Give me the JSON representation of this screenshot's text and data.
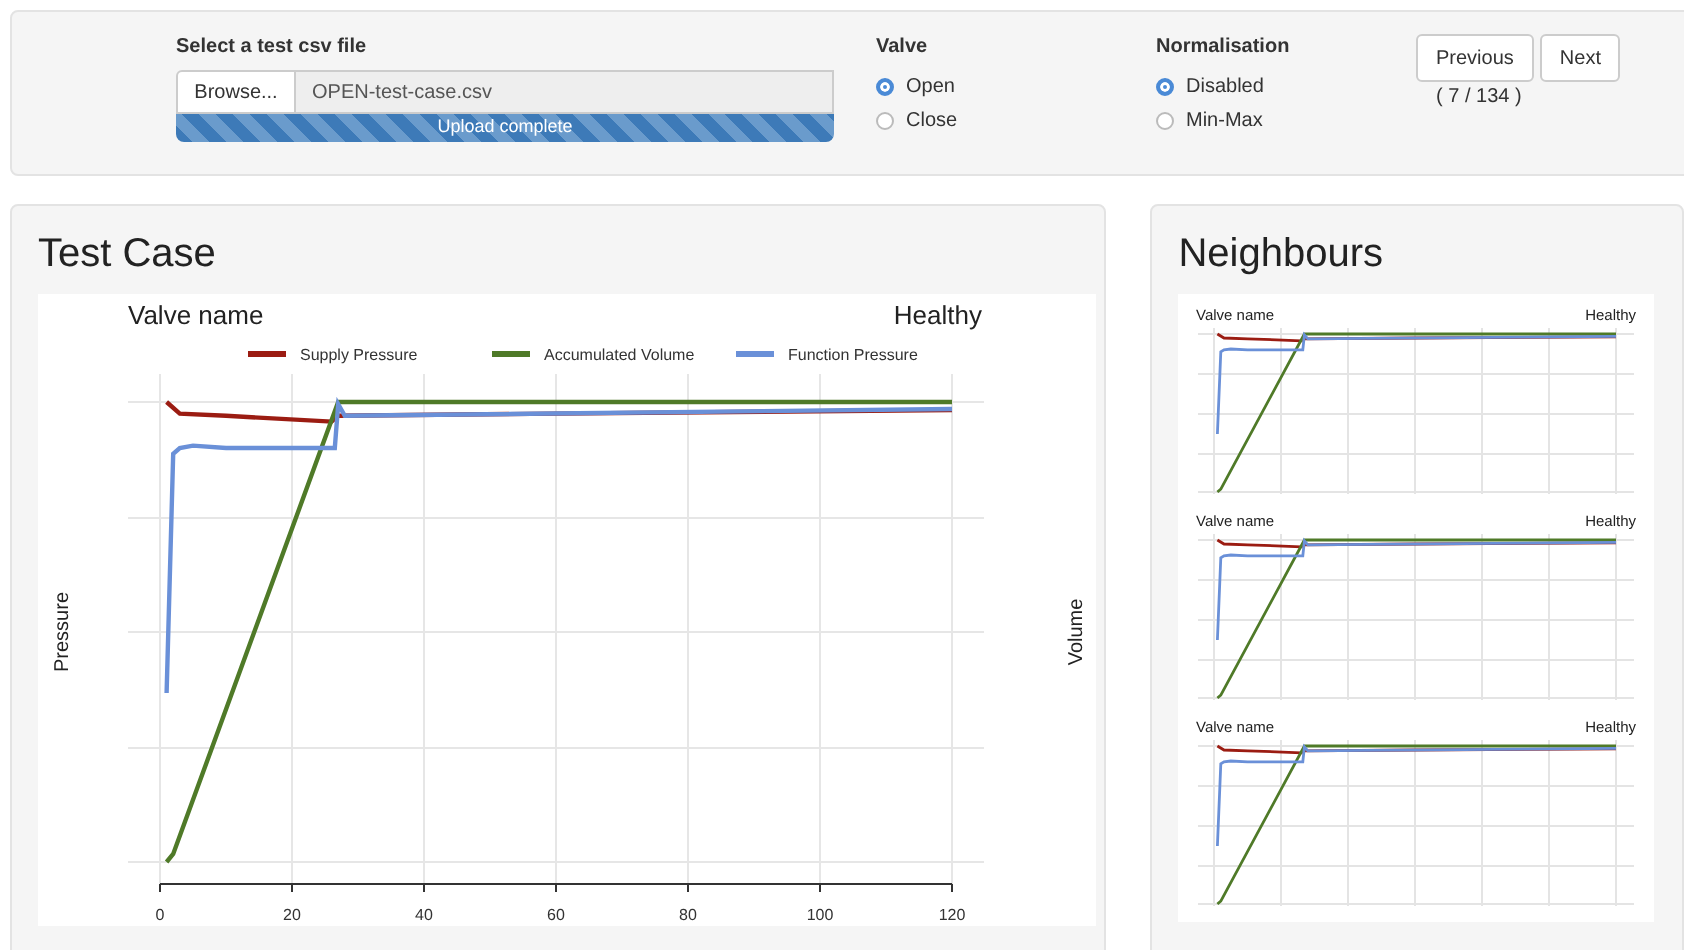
{
  "file_input": {
    "label": "Select a test csv file",
    "button": "Browse...",
    "value": "OPEN-test-case.csv",
    "progress": {
      "level": 1,
      "text": "Upload complete"
    }
  },
  "valve": {
    "label": "Valve",
    "options": [
      {
        "label": "Open",
        "selected": true
      },
      {
        "label": "Close",
        "selected": false
      }
    ]
  },
  "normalisation": {
    "label": "Normalisation",
    "options": [
      {
        "label": "Disabled",
        "selected": true
      },
      {
        "label": "Min-Max",
        "selected": false
      }
    ]
  },
  "pager": {
    "buttons": [
      "Previous",
      "Next"
    ],
    "position": "( 7 / 134 )"
  },
  "test_case": {
    "title": "Test Case",
    "chart": {
      "title": "Valve name",
      "status": "Healthy",
      "ylabel": "Pressure",
      "y2label": "Volume",
      "legend": [
        {
          "name": "Supply Pressure",
          "color": "#9b1c12"
        },
        {
          "name": "Accumulated Volume",
          "color": "#4f7a28"
        },
        {
          "name": "Function Pressure",
          "color": "#6a90d8"
        }
      ],
      "xticks": [
        "0",
        "20",
        "40",
        "60",
        "80",
        "100",
        "120"
      ]
    }
  },
  "neighbours": {
    "title": "Neighbours",
    "charts": [
      {
        "title": "Valve name",
        "status": "Healthy"
      },
      {
        "title": "Valve name",
        "status": "Healthy"
      },
      {
        "title": "Valve name",
        "status": "Healthy"
      }
    ]
  }
}
